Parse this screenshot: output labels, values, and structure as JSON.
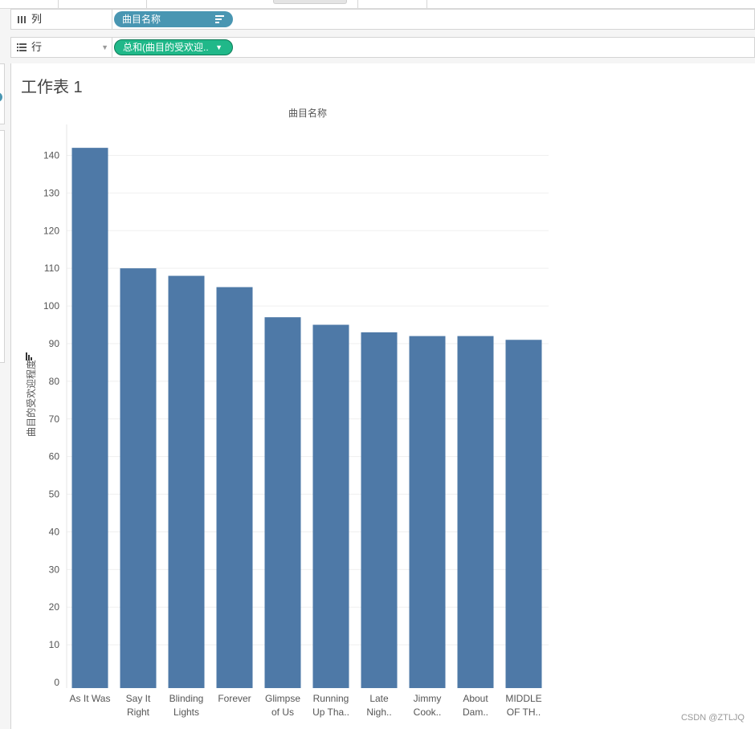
{
  "shelves": {
    "columns": {
      "label": "列",
      "field": "曲目名称",
      "icon": "columns-icon"
    },
    "rows": {
      "label": "行",
      "field": "总和(曲目的受欢迎..",
      "icon": "rows-icon"
    }
  },
  "sheet": {
    "title": "工作表 1"
  },
  "watermark": "CSDN @ZTLJQ",
  "chart_data": {
    "type": "bar",
    "title": "曲目名称",
    "ylabel": "曲目的受欢迎程度",
    "categories": [
      [
        "As It Was"
      ],
      [
        "Say It",
        "Right"
      ],
      [
        "Blinding",
        "Lights"
      ],
      [
        "Forever"
      ],
      [
        "Glimpse",
        "of Us"
      ],
      [
        "Running",
        "Up Tha.."
      ],
      [
        "Late",
        "Nigh.."
      ],
      [
        "Jimmy",
        "Cook.."
      ],
      [
        "About",
        "Dam.."
      ],
      [
        "MIDDLE",
        "OF TH.."
      ]
    ],
    "values": [
      142,
      110,
      108,
      105,
      97,
      95,
      93,
      92,
      92,
      91
    ],
    "yticks": [
      0,
      10,
      20,
      30,
      40,
      50,
      60,
      70,
      80,
      90,
      100,
      110,
      120,
      130,
      140
    ],
    "ylim": [
      -1.5,
      150
    ],
    "bar_color": "#4e79a7",
    "grid": true
  },
  "colors": {
    "dimension_pill": "#4996b2",
    "measure_pill": "#20b889",
    "bar": "#4e79a7"
  }
}
